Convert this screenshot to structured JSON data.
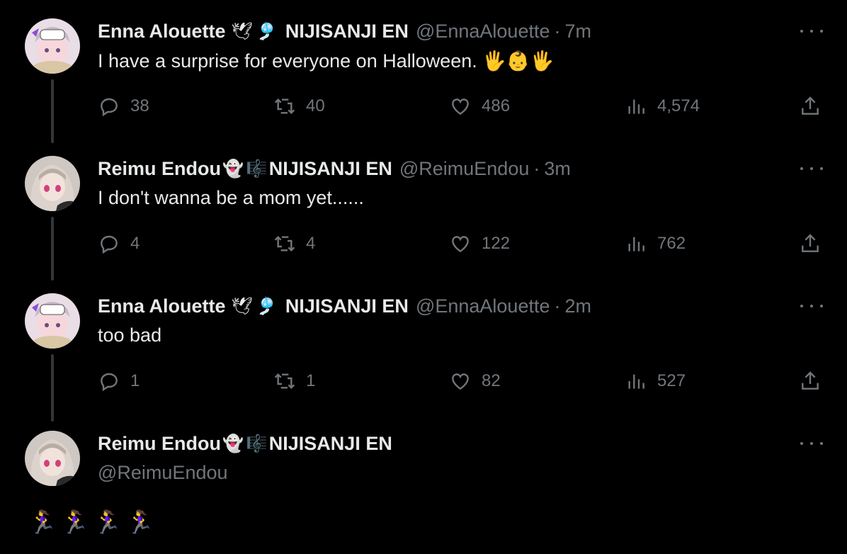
{
  "tweets": [
    {
      "name": "Enna Alouette",
      "emojis": [
        "🕊",
        "🎐"
      ],
      "affiliation": "NIJISANJI EN",
      "handle": "@EnnaAlouette",
      "time": "7m",
      "text": "I have a surprise for everyone on Halloween. 🖐👶🖐",
      "replies": "38",
      "reposts": "40",
      "likes": "486",
      "views": "4,574"
    },
    {
      "name": "Reimu Endou",
      "emojis": [
        "👻",
        "🎼"
      ],
      "affiliation": "NIJISANJI EN",
      "handle": "@ReimuEndou",
      "time": "3m",
      "text": "I don't wanna be a mom yet......",
      "replies": "4",
      "reposts": "4",
      "likes": "122",
      "views": "762"
    },
    {
      "name": "Enna Alouette",
      "emojis": [
        "🕊",
        "🎐"
      ],
      "affiliation": "NIJISANJI EN",
      "handle": "@EnnaAlouette",
      "time": "2m",
      "text": "too bad",
      "replies": "1",
      "reposts": "1",
      "likes": "82",
      "views": "527"
    }
  ],
  "compose": {
    "name": "Reimu Endou",
    "emojis": [
      "👻",
      "🎼"
    ],
    "affiliation": "NIJISANJI EN",
    "handle": "@ReimuEndou",
    "text": "🏃‍♀️🏃‍♀️🏃‍♀️🏃‍♀️"
  },
  "separator": "·",
  "icons": {
    "reply": "reply-icon",
    "repost": "repost-icon",
    "like": "heart-icon",
    "views": "views-icon",
    "share": "share-icon",
    "more": "more-icon"
  },
  "colors": {
    "background": "#000000",
    "text": "#e7e9ea",
    "secondary": "#71767b",
    "thread_line": "#333639"
  }
}
